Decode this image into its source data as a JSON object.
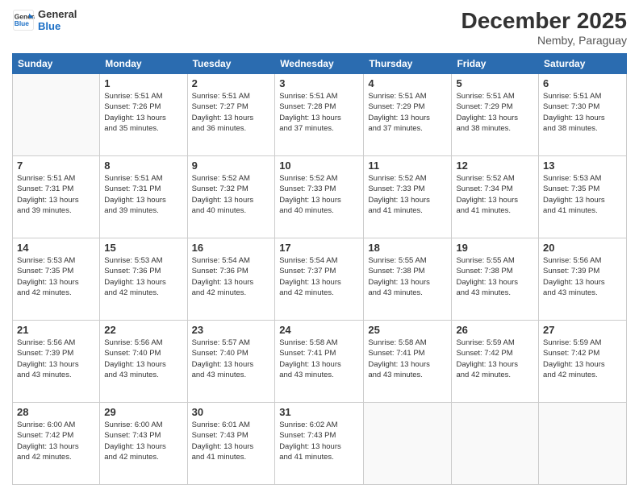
{
  "header": {
    "logo_line1": "General",
    "logo_line2": "Blue",
    "month_year": "December 2025",
    "location": "Nemby, Paraguay"
  },
  "days_of_week": [
    "Sunday",
    "Monday",
    "Tuesday",
    "Wednesday",
    "Thursday",
    "Friday",
    "Saturday"
  ],
  "weeks": [
    [
      {
        "day": "",
        "info": ""
      },
      {
        "day": "1",
        "info": "Sunrise: 5:51 AM\nSunset: 7:26 PM\nDaylight: 13 hours\nand 35 minutes."
      },
      {
        "day": "2",
        "info": "Sunrise: 5:51 AM\nSunset: 7:27 PM\nDaylight: 13 hours\nand 36 minutes."
      },
      {
        "day": "3",
        "info": "Sunrise: 5:51 AM\nSunset: 7:28 PM\nDaylight: 13 hours\nand 37 minutes."
      },
      {
        "day": "4",
        "info": "Sunrise: 5:51 AM\nSunset: 7:29 PM\nDaylight: 13 hours\nand 37 minutes."
      },
      {
        "day": "5",
        "info": "Sunrise: 5:51 AM\nSunset: 7:29 PM\nDaylight: 13 hours\nand 38 minutes."
      },
      {
        "day": "6",
        "info": "Sunrise: 5:51 AM\nSunset: 7:30 PM\nDaylight: 13 hours\nand 38 minutes."
      }
    ],
    [
      {
        "day": "7",
        "info": "Sunrise: 5:51 AM\nSunset: 7:31 PM\nDaylight: 13 hours\nand 39 minutes."
      },
      {
        "day": "8",
        "info": "Sunrise: 5:51 AM\nSunset: 7:31 PM\nDaylight: 13 hours\nand 39 minutes."
      },
      {
        "day": "9",
        "info": "Sunrise: 5:52 AM\nSunset: 7:32 PM\nDaylight: 13 hours\nand 40 minutes."
      },
      {
        "day": "10",
        "info": "Sunrise: 5:52 AM\nSunset: 7:33 PM\nDaylight: 13 hours\nand 40 minutes."
      },
      {
        "day": "11",
        "info": "Sunrise: 5:52 AM\nSunset: 7:33 PM\nDaylight: 13 hours\nand 41 minutes."
      },
      {
        "day": "12",
        "info": "Sunrise: 5:52 AM\nSunset: 7:34 PM\nDaylight: 13 hours\nand 41 minutes."
      },
      {
        "day": "13",
        "info": "Sunrise: 5:53 AM\nSunset: 7:35 PM\nDaylight: 13 hours\nand 41 minutes."
      }
    ],
    [
      {
        "day": "14",
        "info": "Sunrise: 5:53 AM\nSunset: 7:35 PM\nDaylight: 13 hours\nand 42 minutes."
      },
      {
        "day": "15",
        "info": "Sunrise: 5:53 AM\nSunset: 7:36 PM\nDaylight: 13 hours\nand 42 minutes."
      },
      {
        "day": "16",
        "info": "Sunrise: 5:54 AM\nSunset: 7:36 PM\nDaylight: 13 hours\nand 42 minutes."
      },
      {
        "day": "17",
        "info": "Sunrise: 5:54 AM\nSunset: 7:37 PM\nDaylight: 13 hours\nand 42 minutes."
      },
      {
        "day": "18",
        "info": "Sunrise: 5:55 AM\nSunset: 7:38 PM\nDaylight: 13 hours\nand 43 minutes."
      },
      {
        "day": "19",
        "info": "Sunrise: 5:55 AM\nSunset: 7:38 PM\nDaylight: 13 hours\nand 43 minutes."
      },
      {
        "day": "20",
        "info": "Sunrise: 5:56 AM\nSunset: 7:39 PM\nDaylight: 13 hours\nand 43 minutes."
      }
    ],
    [
      {
        "day": "21",
        "info": "Sunrise: 5:56 AM\nSunset: 7:39 PM\nDaylight: 13 hours\nand 43 minutes."
      },
      {
        "day": "22",
        "info": "Sunrise: 5:56 AM\nSunset: 7:40 PM\nDaylight: 13 hours\nand 43 minutes."
      },
      {
        "day": "23",
        "info": "Sunrise: 5:57 AM\nSunset: 7:40 PM\nDaylight: 13 hours\nand 43 minutes."
      },
      {
        "day": "24",
        "info": "Sunrise: 5:58 AM\nSunset: 7:41 PM\nDaylight: 13 hours\nand 43 minutes."
      },
      {
        "day": "25",
        "info": "Sunrise: 5:58 AM\nSunset: 7:41 PM\nDaylight: 13 hours\nand 43 minutes."
      },
      {
        "day": "26",
        "info": "Sunrise: 5:59 AM\nSunset: 7:42 PM\nDaylight: 13 hours\nand 42 minutes."
      },
      {
        "day": "27",
        "info": "Sunrise: 5:59 AM\nSunset: 7:42 PM\nDaylight: 13 hours\nand 42 minutes."
      }
    ],
    [
      {
        "day": "28",
        "info": "Sunrise: 6:00 AM\nSunset: 7:42 PM\nDaylight: 13 hours\nand 42 minutes."
      },
      {
        "day": "29",
        "info": "Sunrise: 6:00 AM\nSunset: 7:43 PM\nDaylight: 13 hours\nand 42 minutes."
      },
      {
        "day": "30",
        "info": "Sunrise: 6:01 AM\nSunset: 7:43 PM\nDaylight: 13 hours\nand 41 minutes."
      },
      {
        "day": "31",
        "info": "Sunrise: 6:02 AM\nSunset: 7:43 PM\nDaylight: 13 hours\nand 41 minutes."
      },
      {
        "day": "",
        "info": ""
      },
      {
        "day": "",
        "info": ""
      },
      {
        "day": "",
        "info": ""
      }
    ]
  ]
}
